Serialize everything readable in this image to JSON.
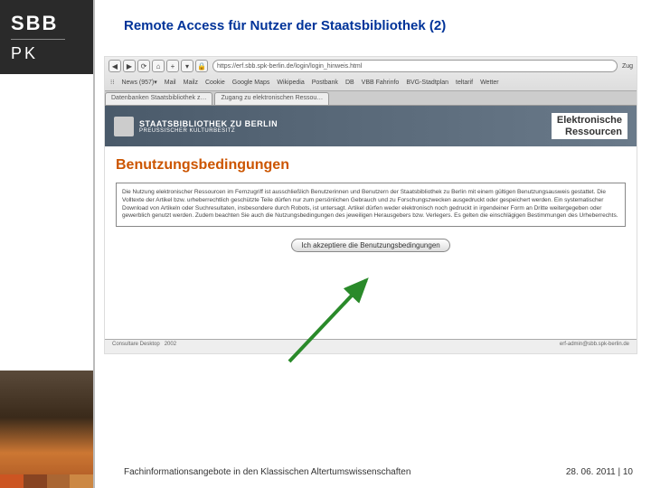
{
  "sidebar": {
    "logo_top": "SBB",
    "logo_bottom": "PK"
  },
  "slide": {
    "title": "Remote Access für Nutzer der Staatsbibliothek (2)",
    "footer_left": "Fachinformationsangebote in den Klassischen Altertumswissenschaften",
    "footer_date": "28. 06. 2011",
    "footer_page": "10"
  },
  "browser": {
    "url": "https://erf.sbb.spk-berlin.de/login/login_hinweis.html",
    "right_label": "Zug",
    "bookmarks": [
      "News (957)▾",
      "Mail",
      "Mailz",
      "Cookie",
      "Google Maps",
      "Wikipedia",
      "Postbank",
      "DB",
      "VBB Fahrinfo",
      "BVG-Stadtplan",
      "teltarif",
      "Wetter"
    ],
    "tabs": [
      "Datenbanken  Staatsbibliothek z…",
      "Zugang zu elektronischen Ressou…"
    ]
  },
  "page": {
    "org_title": "STAATSBIBLIOTHEK ZU BERLIN",
    "org_sub": "PREUSSISCHER KULTURBESITZ",
    "banner_line1": "Elektronische",
    "banner_line2": "Ressourcen",
    "heading": "Benutzungsbedingungen",
    "terms": "Die Nutzung elektronischer Ressourcen im Fernzugriff ist ausschließlich Benutzerinnen und Benutzern der Staatsbibliothek zu Berlin mit einem gültigen Benutzungsausweis gestattet. Die Volltexte der Artikel bzw. urheberrechtlich geschützte Teile dürfen nur zum persönlichen Gebrauch und zu Forschungszwecken ausgedruckt oder gespeichert werden. Ein systematischer Download von Artikeln oder Suchresultaten, insbesondere durch Robots, ist untersagt. Artikel dürfen weder elektronisch noch gedruckt in irgendeiner Form an Dritte weitergegeben oder gewerblich genutzt werden. Zudem beachten Sie auch die Nutzungsbedingungen des jeweiligen Herausgebers bzw. Verlegers. Es gelten die einschlägigen Bestimmungen des Urheberrechts.",
    "accept_label": "Ich akzeptiere die Benutzungsbedingungen",
    "footer_left": "Consultare Desktop",
    "footer_year": "2002",
    "footer_right": "erf-admin@sbb.spk-berlin.de"
  }
}
